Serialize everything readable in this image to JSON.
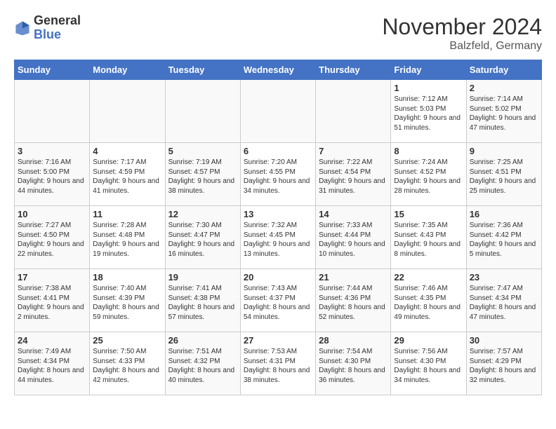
{
  "header": {
    "logo_general": "General",
    "logo_blue": "Blue",
    "month_title": "November 2024",
    "location": "Balzfeld, Germany"
  },
  "days_of_week": [
    "Sunday",
    "Monday",
    "Tuesday",
    "Wednesday",
    "Thursday",
    "Friday",
    "Saturday"
  ],
  "weeks": [
    [
      {
        "day": "",
        "empty": true
      },
      {
        "day": "",
        "empty": true
      },
      {
        "day": "",
        "empty": true
      },
      {
        "day": "",
        "empty": true
      },
      {
        "day": "",
        "empty": true
      },
      {
        "day": "1",
        "sunrise": "Sunrise: 7:12 AM",
        "sunset": "Sunset: 5:03 PM",
        "daylight": "Daylight: 9 hours and 51 minutes."
      },
      {
        "day": "2",
        "sunrise": "Sunrise: 7:14 AM",
        "sunset": "Sunset: 5:02 PM",
        "daylight": "Daylight: 9 hours and 47 minutes."
      }
    ],
    [
      {
        "day": "3",
        "sunrise": "Sunrise: 7:16 AM",
        "sunset": "Sunset: 5:00 PM",
        "daylight": "Daylight: 9 hours and 44 minutes."
      },
      {
        "day": "4",
        "sunrise": "Sunrise: 7:17 AM",
        "sunset": "Sunset: 4:59 PM",
        "daylight": "Daylight: 9 hours and 41 minutes."
      },
      {
        "day": "5",
        "sunrise": "Sunrise: 7:19 AM",
        "sunset": "Sunset: 4:57 PM",
        "daylight": "Daylight: 9 hours and 38 minutes."
      },
      {
        "day": "6",
        "sunrise": "Sunrise: 7:20 AM",
        "sunset": "Sunset: 4:55 PM",
        "daylight": "Daylight: 9 hours and 34 minutes."
      },
      {
        "day": "7",
        "sunrise": "Sunrise: 7:22 AM",
        "sunset": "Sunset: 4:54 PM",
        "daylight": "Daylight: 9 hours and 31 minutes."
      },
      {
        "day": "8",
        "sunrise": "Sunrise: 7:24 AM",
        "sunset": "Sunset: 4:52 PM",
        "daylight": "Daylight: 9 hours and 28 minutes."
      },
      {
        "day": "9",
        "sunrise": "Sunrise: 7:25 AM",
        "sunset": "Sunset: 4:51 PM",
        "daylight": "Daylight: 9 hours and 25 minutes."
      }
    ],
    [
      {
        "day": "10",
        "sunrise": "Sunrise: 7:27 AM",
        "sunset": "Sunset: 4:50 PM",
        "daylight": "Daylight: 9 hours and 22 minutes."
      },
      {
        "day": "11",
        "sunrise": "Sunrise: 7:28 AM",
        "sunset": "Sunset: 4:48 PM",
        "daylight": "Daylight: 9 hours and 19 minutes."
      },
      {
        "day": "12",
        "sunrise": "Sunrise: 7:30 AM",
        "sunset": "Sunset: 4:47 PM",
        "daylight": "Daylight: 9 hours and 16 minutes."
      },
      {
        "day": "13",
        "sunrise": "Sunrise: 7:32 AM",
        "sunset": "Sunset: 4:45 PM",
        "daylight": "Daylight: 9 hours and 13 minutes."
      },
      {
        "day": "14",
        "sunrise": "Sunrise: 7:33 AM",
        "sunset": "Sunset: 4:44 PM",
        "daylight": "Daylight: 9 hours and 10 minutes."
      },
      {
        "day": "15",
        "sunrise": "Sunrise: 7:35 AM",
        "sunset": "Sunset: 4:43 PM",
        "daylight": "Daylight: 9 hours and 8 minutes."
      },
      {
        "day": "16",
        "sunrise": "Sunrise: 7:36 AM",
        "sunset": "Sunset: 4:42 PM",
        "daylight": "Daylight: 9 hours and 5 minutes."
      }
    ],
    [
      {
        "day": "17",
        "sunrise": "Sunrise: 7:38 AM",
        "sunset": "Sunset: 4:41 PM",
        "daylight": "Daylight: 9 hours and 2 minutes."
      },
      {
        "day": "18",
        "sunrise": "Sunrise: 7:40 AM",
        "sunset": "Sunset: 4:39 PM",
        "daylight": "Daylight: 8 hours and 59 minutes."
      },
      {
        "day": "19",
        "sunrise": "Sunrise: 7:41 AM",
        "sunset": "Sunset: 4:38 PM",
        "daylight": "Daylight: 8 hours and 57 minutes."
      },
      {
        "day": "20",
        "sunrise": "Sunrise: 7:43 AM",
        "sunset": "Sunset: 4:37 PM",
        "daylight": "Daylight: 8 hours and 54 minutes."
      },
      {
        "day": "21",
        "sunrise": "Sunrise: 7:44 AM",
        "sunset": "Sunset: 4:36 PM",
        "daylight": "Daylight: 8 hours and 52 minutes."
      },
      {
        "day": "22",
        "sunrise": "Sunrise: 7:46 AM",
        "sunset": "Sunset: 4:35 PM",
        "daylight": "Daylight: 8 hours and 49 minutes."
      },
      {
        "day": "23",
        "sunrise": "Sunrise: 7:47 AM",
        "sunset": "Sunset: 4:34 PM",
        "daylight": "Daylight: 8 hours and 47 minutes."
      }
    ],
    [
      {
        "day": "24",
        "sunrise": "Sunrise: 7:49 AM",
        "sunset": "Sunset: 4:34 PM",
        "daylight": "Daylight: 8 hours and 44 minutes."
      },
      {
        "day": "25",
        "sunrise": "Sunrise: 7:50 AM",
        "sunset": "Sunset: 4:33 PM",
        "daylight": "Daylight: 8 hours and 42 minutes."
      },
      {
        "day": "26",
        "sunrise": "Sunrise: 7:51 AM",
        "sunset": "Sunset: 4:32 PM",
        "daylight": "Daylight: 8 hours and 40 minutes."
      },
      {
        "day": "27",
        "sunrise": "Sunrise: 7:53 AM",
        "sunset": "Sunset: 4:31 PM",
        "daylight": "Daylight: 8 hours and 38 minutes."
      },
      {
        "day": "28",
        "sunrise": "Sunrise: 7:54 AM",
        "sunset": "Sunset: 4:30 PM",
        "daylight": "Daylight: 8 hours and 36 minutes."
      },
      {
        "day": "29",
        "sunrise": "Sunrise: 7:56 AM",
        "sunset": "Sunset: 4:30 PM",
        "daylight": "Daylight: 8 hours and 34 minutes."
      },
      {
        "day": "30",
        "sunrise": "Sunrise: 7:57 AM",
        "sunset": "Sunset: 4:29 PM",
        "daylight": "Daylight: 8 hours and 32 minutes."
      }
    ]
  ]
}
